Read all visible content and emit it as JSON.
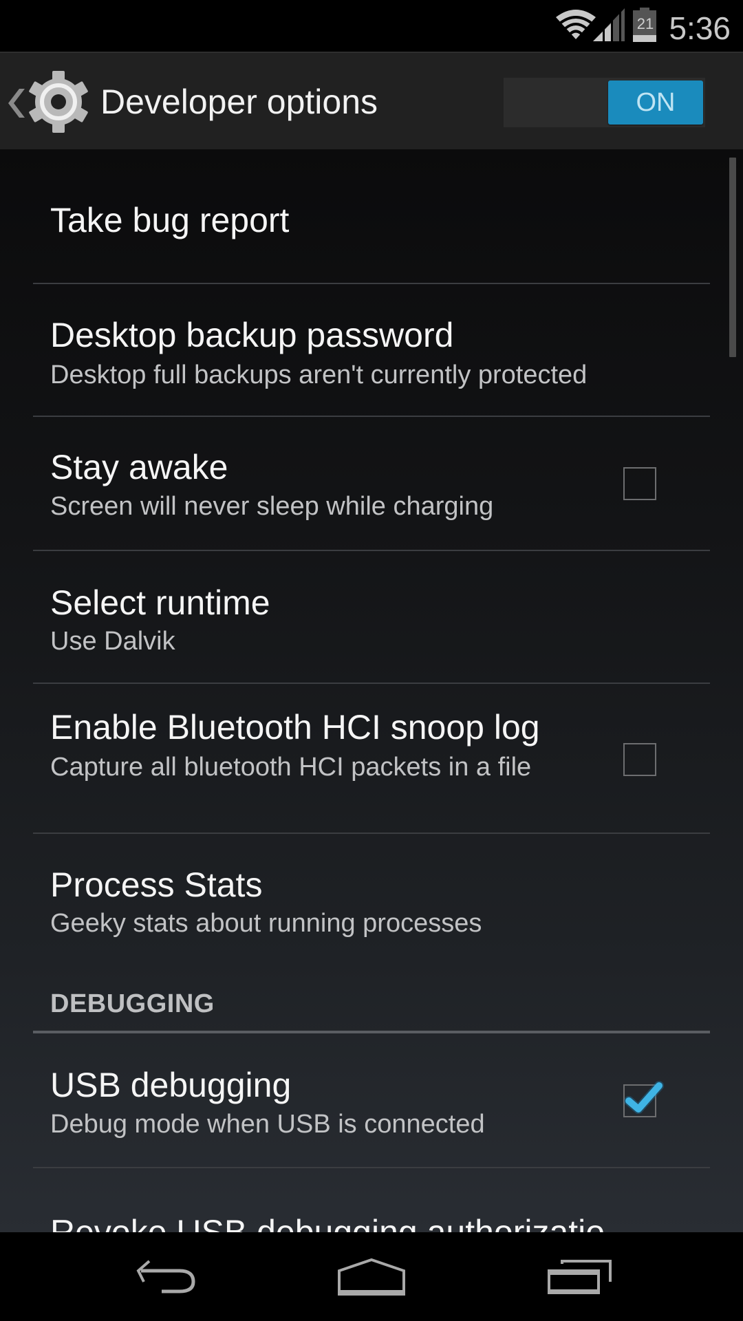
{
  "status_bar": {
    "time": "5:36",
    "battery_level": "21",
    "icons": [
      "wifi-icon",
      "cell-signal-icon",
      "battery-icon"
    ]
  },
  "header": {
    "title": "Developer options",
    "icon": "settings-gear-icon",
    "back_icon": "chevron-left-icon",
    "master_switch": {
      "label": "ON",
      "state": true
    }
  },
  "colors": {
    "accent": "#1a8bbd",
    "check": "#3fb4e5",
    "title_text": "#f5f5f5",
    "summary_text": "#c2c3c5"
  },
  "preferences": [
    {
      "title": "Take bug report"
    },
    {
      "title": "Desktop backup password",
      "summary": "Desktop full backups aren't currently protected"
    },
    {
      "title": "Stay awake",
      "summary": "Screen will never sleep while charging",
      "checked": false
    },
    {
      "title": "Select runtime",
      "summary": "Use Dalvik"
    },
    {
      "title": "Enable Bluetooth HCI snoop log",
      "summary": "Capture all bluetooth HCI packets in a file",
      "checked": false
    },
    {
      "title": "Process Stats",
      "summary": "Geeky stats about running processes"
    }
  ],
  "debugging": {
    "category": "DEBUGGING",
    "items": [
      {
        "title": "USB debugging",
        "summary": "Debug mode when USB is connected",
        "checked": true
      },
      {
        "title": "Revoke USB debugging authorizatio"
      }
    ]
  },
  "nav_bar": {
    "buttons": [
      "back-icon",
      "home-icon",
      "recent-apps-icon"
    ]
  }
}
